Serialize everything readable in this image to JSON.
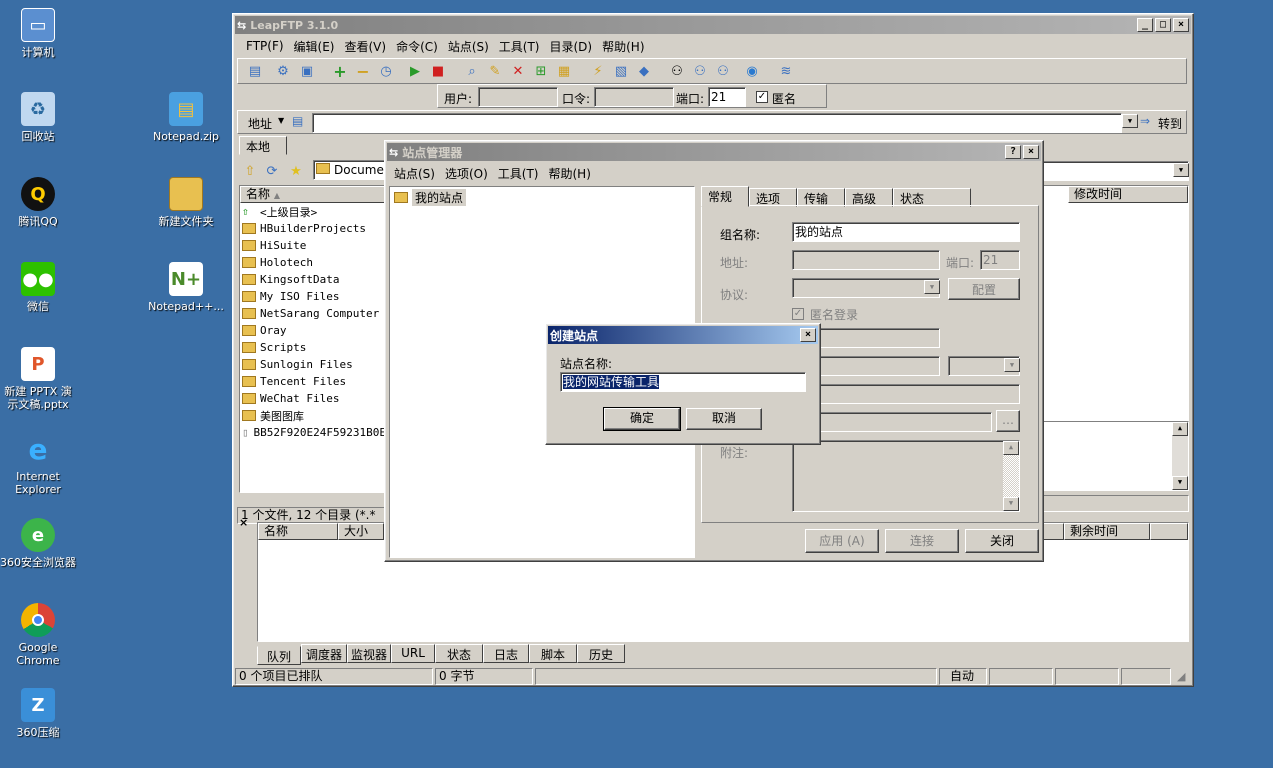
{
  "desktop": {
    "icons": [
      {
        "label": "计算机",
        "icon": "computer-icon"
      },
      {
        "label": "回收站",
        "icon": "recycle-bin-icon"
      },
      {
        "label": "腾讯QQ",
        "icon": "qq-icon"
      },
      {
        "label": "微信",
        "icon": "wechat-icon"
      },
      {
        "label": "新建 PPTX 演示文稿.pptx",
        "icon": "pptx-icon"
      },
      {
        "label": "Internet Explorer",
        "icon": "ie-icon"
      },
      {
        "label": "360安全浏览器",
        "icon": "360-browser-icon"
      },
      {
        "label": "Google Chrome",
        "icon": "chrome-icon"
      },
      {
        "label": "360压缩",
        "icon": "360-zip-icon"
      },
      {
        "label": "Notepad.zip",
        "icon": "zip-icon"
      },
      {
        "label": "新建文件夹",
        "icon": "folder-icon"
      },
      {
        "label": "Notepad++...",
        "icon": "notepadpp-icon"
      }
    ]
  },
  "main_window": {
    "title": "LeapFTP 3.1.0",
    "menu": [
      "FTP(F)",
      "编辑(E)",
      "查看(V)",
      "命令(C)",
      "站点(S)",
      "工具(T)",
      "目录(D)",
      "帮助(H)"
    ],
    "login": {
      "user_label": "用户:",
      "user_value": "",
      "pass_label": "口令:",
      "pass_value": "",
      "port_label": "端口:",
      "port_value": "21",
      "anon_label": "匿名",
      "anon_checked": true
    },
    "address": {
      "label": "地址",
      "value": "",
      "go_label": "转到"
    },
    "local": {
      "tab": "本地",
      "path": "Document",
      "col_name": "名称",
      "rows": [
        {
          "name": "<上级目录>",
          "type": "up"
        },
        {
          "name": "HBuilderProjects",
          "type": "folder"
        },
        {
          "name": "HiSuite",
          "type": "folder"
        },
        {
          "name": "Holotech",
          "type": "folder"
        },
        {
          "name": "KingsoftData",
          "type": "folder"
        },
        {
          "name": "My ISO Files",
          "type": "folder"
        },
        {
          "name": "NetSarang Computer",
          "type": "folder"
        },
        {
          "name": "Oray",
          "type": "folder"
        },
        {
          "name": "Scripts",
          "type": "folder"
        },
        {
          "name": "Sunlogin Files",
          "type": "folder"
        },
        {
          "name": "Tencent Files",
          "type": "folder"
        },
        {
          "name": "WeChat Files",
          "type": "folder"
        },
        {
          "name": "美图图库",
          "type": "folder"
        },
        {
          "name": "BB52F920E24F59231B0E",
          "type": "file"
        }
      ],
      "status": "1 个文件, 12 个目录 (*.*"
    },
    "remote": {
      "col_modified": "修改时间"
    },
    "queue": {
      "col_name": "名称",
      "col_size": "大小",
      "col_remaining": "剩余时间",
      "tabs": [
        "队列",
        "调度器",
        "监视器",
        "URL",
        "状态",
        "日志",
        "脚本",
        "历史"
      ]
    },
    "statusbar": {
      "queued": "0 个项目已排队",
      "bytes": "0 字节",
      "mode": "自动"
    }
  },
  "site_manager": {
    "title": "站点管理器",
    "menu": [
      "站点(S)",
      "选项(O)",
      "工具(T)",
      "帮助(H)"
    ],
    "tree_root": "我的站点",
    "tabs": [
      "常规",
      "选项",
      "传输",
      "高级",
      "状态"
    ],
    "group_label": "组名称:",
    "group_value": "我的站点",
    "address_label": "地址:",
    "port_label": "端口:",
    "port_value": "21",
    "protocol_label": "协议:",
    "config_button": "配置",
    "anon_login_label": "匿名登录",
    "notes_label": "附注:",
    "apply_button": "应用 (A)",
    "connect_button": "连接",
    "close_button": "关闭"
  },
  "create_site": {
    "title": "创建站点",
    "name_label": "站点名称:",
    "name_value": "我的网站传输工具",
    "ok_button": "确定",
    "cancel_button": "取消"
  }
}
